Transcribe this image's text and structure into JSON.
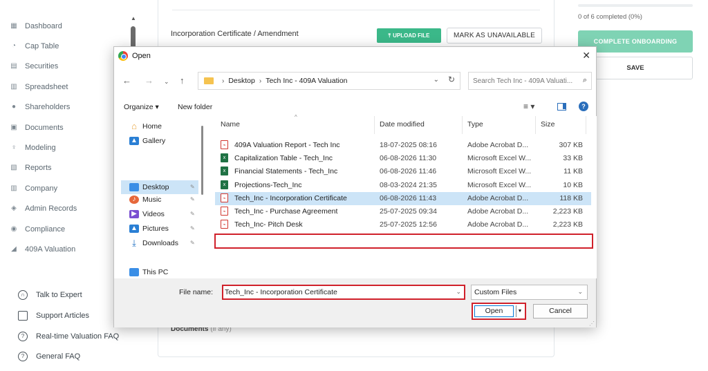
{
  "sidebar": {
    "items": [
      {
        "label": "Dashboard",
        "icon": "dashboard-icon"
      },
      {
        "label": "Cap Table",
        "icon": "pie-chart-icon"
      },
      {
        "label": "Securities",
        "icon": "clipboard-icon"
      },
      {
        "label": "Spreadsheet",
        "icon": "spreadsheet-icon"
      },
      {
        "label": "Shareholders",
        "icon": "person-icon"
      },
      {
        "label": "Documents",
        "icon": "folder-icon"
      },
      {
        "label": "Modeling",
        "icon": "bulb-icon"
      },
      {
        "label": "Reports",
        "icon": "report-icon"
      },
      {
        "label": "Company",
        "icon": "building-icon"
      },
      {
        "label": "Admin Records",
        "icon": "admin-icon"
      },
      {
        "label": "Compliance",
        "icon": "shield-icon"
      },
      {
        "label": "409A Valuation",
        "icon": "chart-icon"
      }
    ],
    "help": [
      {
        "label": "Talk to Expert",
        "icon": "headset-icon"
      },
      {
        "label": "Support Articles",
        "icon": "book-icon"
      },
      {
        "label": "Real-time Valuation FAQ",
        "icon": "question-icon"
      },
      {
        "label": "General FAQ",
        "icon": "question-icon"
      }
    ]
  },
  "main": {
    "doc_title": "Incorporation Certificate / Amendment",
    "upload_label": "UPLOAD FILE",
    "unavailable_label": "MARK AS UNAVAILABLE",
    "documents_label": "Documents",
    "documents_suffix": "(if any)"
  },
  "onboarding": {
    "progress_text": "0 of 6 completed (0%)",
    "progress_fraction": 0,
    "complete_label": "COMPLETE ONBOARDING",
    "save_label": "SAVE"
  },
  "dialog": {
    "title": "Open",
    "close": "✕",
    "breadcrumb": [
      "Desktop",
      "Tech Inc - 409A Valuation"
    ],
    "search_placeholder": "Search Tech Inc - 409A Valuati...",
    "organize_label": "Organize ▾",
    "new_folder_label": "New folder",
    "nav_pane": [
      {
        "label": "Home",
        "icon": "home-icon"
      },
      {
        "label": "Gallery",
        "icon": "gallery-icon"
      },
      {
        "label": "Desktop",
        "icon": "desktop-icon",
        "selected": true
      },
      {
        "label": "Music",
        "icon": "music-icon"
      },
      {
        "label": "Videos",
        "icon": "videos-icon"
      },
      {
        "label": "Pictures",
        "icon": "pictures-icon"
      },
      {
        "label": "Downloads",
        "icon": "downloads-icon"
      },
      {
        "label": "This PC",
        "icon": "this-pc-icon"
      }
    ],
    "columns": [
      "Name",
      "Date modified",
      "Type",
      "Size"
    ],
    "files": [
      {
        "name": "409A Valuation Report - Tech Inc",
        "date": "18-07-2025 08:16",
        "type": "Adobe Acrobat D...",
        "size": "307 KB",
        "kind": "pdf"
      },
      {
        "name": "Capitalization Table - Tech_Inc",
        "date": "06-08-2026 11:30",
        "type": "Microsoft Excel W...",
        "size": "33 KB",
        "kind": "xls"
      },
      {
        "name": "Financial Statements - Tech_Inc",
        "date": "06-08-2026 11:46",
        "type": "Microsoft Excel W...",
        "size": "11 KB",
        "kind": "xls"
      },
      {
        "name": "Projections-Tech_Inc",
        "date": "08-03-2024 21:35",
        "type": "Microsoft Excel W...",
        "size": "10 KB",
        "kind": "xls"
      },
      {
        "name": "Tech_Inc - Incorporation Certificate",
        "date": "06-08-2026 11:43",
        "type": "Adobe Acrobat D...",
        "size": "118 KB",
        "kind": "pdf",
        "selected": true
      },
      {
        "name": "Tech_Inc - Purchase Agreement",
        "date": "25-07-2025 09:34",
        "type": "Adobe Acrobat D...",
        "size": "2,223 KB",
        "kind": "pdf"
      },
      {
        "name": "Tech_Inc- Pitch Desk",
        "date": "25-07-2025 12:56",
        "type": "Adobe Acrobat D...",
        "size": "2,223 KB",
        "kind": "pdf"
      }
    ],
    "file_name_label": "File name:",
    "file_name_value": "Tech_Inc - Incorporation Certificate",
    "filter_value": "Custom Files",
    "open_label": "Open",
    "cancel_label": "Cancel"
  },
  "colors": {
    "accent_green": "#3bb889",
    "highlight_red": "#d0202a",
    "selection_blue": "#cce4f7"
  }
}
